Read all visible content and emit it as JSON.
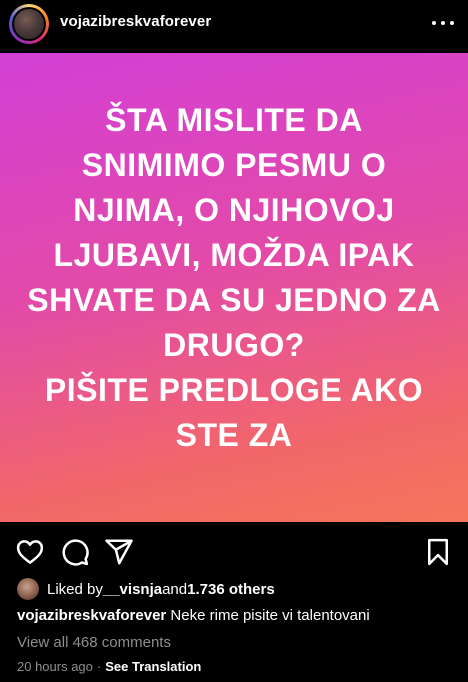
{
  "header": {
    "username": "vojazibreskvaforever",
    "avatar_icon": "profile-photo",
    "more_icon": "more-horizontal-icon"
  },
  "post": {
    "background_colors": [
      "#d33fd6",
      "#e34aa8",
      "#f2676a",
      "#f5755a"
    ],
    "lines": [
      "ŠTA MISLITE DA",
      "SNIMIMO PESMU O",
      "NJIMA, O NJIHOVOJ",
      "LJUBAVI, MOŽDA IPAK",
      "SHVATE DA SU JEDNO ZA",
      "DRUGO?",
      "PIŠITE PREDLOGE AKO",
      "STE ZA"
    ]
  },
  "actions": {
    "like_icon": "heart-icon",
    "comment_icon": "comment-icon",
    "share_icon": "send-icon",
    "save_icon": "bookmark-icon"
  },
  "likes": {
    "prefix": "Liked by ",
    "user": "__visnja",
    "middle": " and ",
    "count": "1.736 others"
  },
  "caption": {
    "username": "vojazibreskvaforever",
    "text": " Neke rime pisite vi talentovani"
  },
  "comments": {
    "view_all": "View all 468 comments"
  },
  "meta": {
    "time": "20 hours ago",
    "separator": "·",
    "translate": "See Translation"
  }
}
